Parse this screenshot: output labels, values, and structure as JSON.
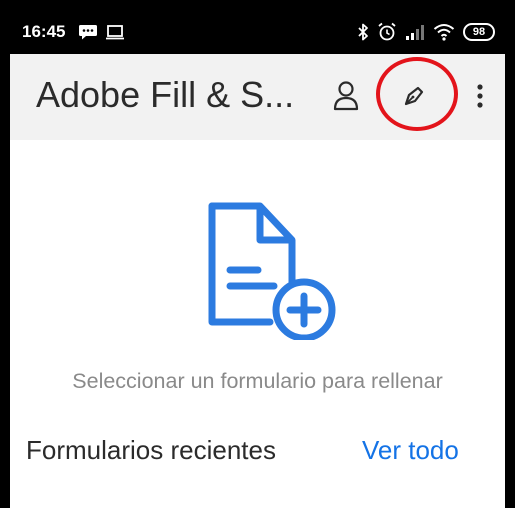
{
  "status_bar": {
    "time": "16:45",
    "battery_level": "98",
    "icons": [
      "message-icon",
      "screen-cast-icon",
      "bluetooth-icon",
      "alarm-icon",
      "signal-icon",
      "wifi-icon",
      "battery-icon"
    ]
  },
  "app_bar": {
    "title": "Adobe Fill & S...",
    "actions": [
      "account-icon",
      "sign-pen-icon",
      "more-vert-icon"
    ],
    "highlight_color": "#e3141b"
  },
  "main": {
    "empty_state_label": "Seleccionar un formulario para rellenar",
    "illustration_icon": "add-document-icon",
    "recent_heading": "Formularios recientes",
    "see_all_label": "Ver todo"
  },
  "colors": {
    "accent": "#1473e6",
    "illustration": "#2c7be0",
    "status_bar_bg": "#000000",
    "app_bar_bg": "#f2f2f2"
  }
}
